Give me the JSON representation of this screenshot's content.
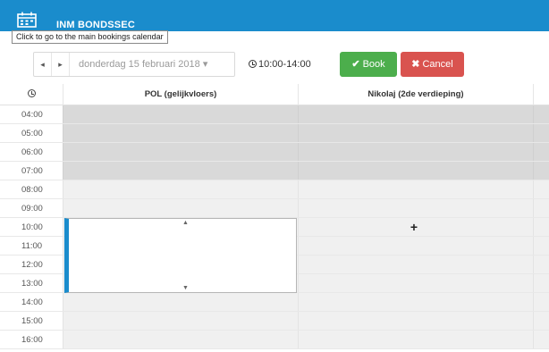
{
  "header": {
    "app_title": "INM BONDSSEC",
    "calendar_icon": "calendar-icon",
    "tooltip": "Click to go to the main bookings calendar",
    "brand_color": "#1a8ccc"
  },
  "toolbar": {
    "prev_icon": "chevron-left-icon",
    "next_icon": "chevron-right-icon",
    "prev_glyph": "◂",
    "next_glyph": "▸",
    "date_label": "donderdag 15 februari 2018 ▾",
    "time_range": "10:00-14:00",
    "book_label": "Book",
    "book_glyph": "✔",
    "book_color": "#4cae4c",
    "cancel_label": "Cancel",
    "cancel_glyph": "✖",
    "cancel_color": "#d9534f"
  },
  "calendar": {
    "resources": [
      "POL (gelijkvloers)",
      "Nikolaj (2de verdieping)"
    ],
    "time_slots": [
      "04:00",
      "05:00",
      "06:00",
      "07:00",
      "08:00",
      "09:00",
      "10:00",
      "11:00",
      "12:00",
      "13:00",
      "14:00",
      "15:00",
      "16:00"
    ],
    "unavailable_slots": [
      "04:00",
      "05:00",
      "06:00",
      "07:00"
    ],
    "selection": {
      "resource": "POL (gelijkvloers)",
      "start": "10:00",
      "end": "14:00",
      "handle_up": "▲",
      "handle_down": "▼"
    },
    "add_glyph": "+"
  }
}
